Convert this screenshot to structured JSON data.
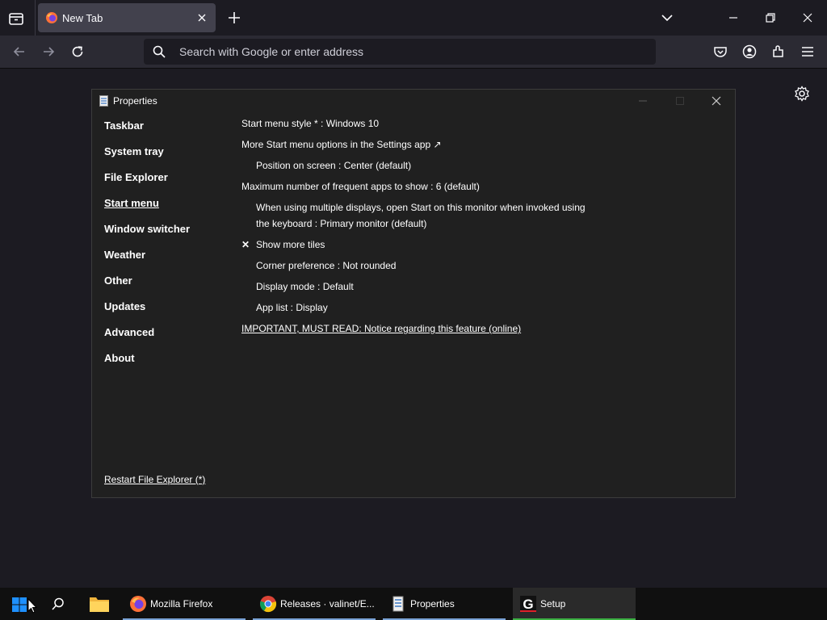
{
  "browser": {
    "tab_title": "New Tab",
    "url_placeholder": "Search with Google or enter address"
  },
  "properties_window": {
    "title": "Properties",
    "sidebar": [
      {
        "label": "Taskbar"
      },
      {
        "label": "System tray"
      },
      {
        "label": "File Explorer"
      },
      {
        "label": "Start menu",
        "active": true
      },
      {
        "label": "Window switcher"
      },
      {
        "label": "Weather"
      },
      {
        "label": "Other"
      },
      {
        "label": "Updates"
      },
      {
        "label": "Advanced"
      },
      {
        "label": "About"
      }
    ],
    "options": {
      "start_menu_style": "Start menu style * : Windows 10",
      "more_options": "More Start menu options in the Settings app ↗",
      "position": "Position on screen : Center (default)",
      "max_frequent": "Maximum number of frequent apps to show : 6 (default)",
      "multi_display_1": "When using multiple displays, open Start on this monitor when invoked using",
      "multi_display_2": "the keyboard : Primary monitor (default)",
      "show_more_tiles_mark": "✕",
      "show_more_tiles": "Show more tiles",
      "corner_pref": "Corner preference : Not rounded",
      "display_mode": "Display mode : Default",
      "app_list": "App list : Display",
      "important": "IMPORTANT, MUST READ: Notice regarding this feature (online)"
    },
    "restart_link": "Restart File Explorer (*)"
  },
  "taskbar": {
    "apps": [
      {
        "label": "Mozilla Firefox"
      },
      {
        "label": "Releases · valinet/E..."
      },
      {
        "label": "Properties"
      },
      {
        "label": "Setup"
      }
    ]
  },
  "colors": {
    "firefox_bg": "#1c1b22",
    "window_bg": "#202020",
    "taskbar_bg": "#101010",
    "accent": "#7aa3d6"
  }
}
